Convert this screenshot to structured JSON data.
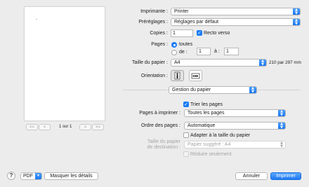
{
  "preview": {
    "page_mark": "-",
    "first_btn": "<<",
    "prev_btn": "<",
    "page_count": "1 sur 1",
    "next_btn": ">",
    "last_btn": ">>"
  },
  "printer": {
    "label": "Imprimante :",
    "value": "Printer"
  },
  "presets": {
    "label": "Préréglages :",
    "value": "Réglages par défaut"
  },
  "copies": {
    "label": "Copies :",
    "value": "1",
    "duplex_label": "Recto verso",
    "duplex_checked": true
  },
  "pages": {
    "label": "Pages :",
    "all_label": "toutes",
    "from_label": "de :",
    "from_value": "1",
    "to_label": "à :",
    "to_value": "1"
  },
  "paper_size": {
    "label": "Taille du papier :",
    "value": "A4",
    "dimensions": "210 par 297 mm"
  },
  "orientation": {
    "label": "Orientation :"
  },
  "section": {
    "value": "Gestion du papier"
  },
  "collate": {
    "label": "Trier les pages",
    "checked": true
  },
  "pages_to_print": {
    "label": "Pages à imprimer :",
    "value": "Toutes les pages"
  },
  "page_order": {
    "label": "Ordre des pages :",
    "value": "Automatique"
  },
  "scale_to_fit": {
    "label": "Adapter à la taille du papier",
    "checked": false
  },
  "dest_paper": {
    "label_line1": "Taille du papier",
    "label_line2": "de destination :",
    "value": "Papier suggéré : A4"
  },
  "scale_down_only": {
    "label": "Réduire seulement"
  },
  "footer": {
    "help": "?",
    "pdf": "PDF",
    "hide_details": "Masquer les détails",
    "cancel": "Annuler",
    "print": "Imprimer"
  }
}
